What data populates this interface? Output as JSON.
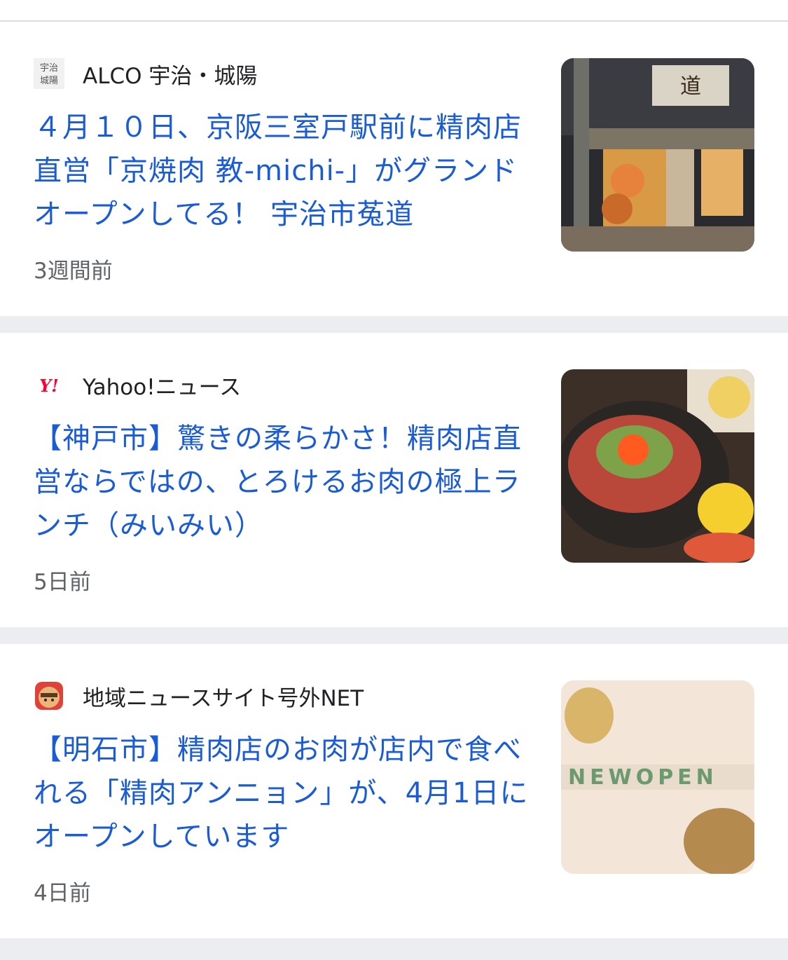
{
  "articles": [
    {
      "source": "ALCO 宇治・城陽",
      "icon": "alco-logo-icon",
      "icon_text": "宇治城陽",
      "headline": "４月１０日、京阪三室戸駅前に精肉店直営「京焼肉 教-michi-」がグランドオープンしてる！ 宇治市菟道",
      "time": "3週間前",
      "thumbnail": "storefront-photo"
    },
    {
      "source": "Yahoo!ニュース",
      "icon": "yahoo-logo-icon",
      "icon_text": "Y!",
      "headline": "【神戸市】驚きの柔らかさ！精肉店直営ならではの、とろけるお肉の極上ランチ（みいみい）",
      "time": "5日前",
      "thumbnail": "beef-bowl-photo"
    },
    {
      "source": "地域ニュースサイト号外NET",
      "icon": "gogai-net-logo-icon",
      "headline": "【明石市】精肉店のお肉が店内で食べれる「精肉アンニョン」が、4月1日にオープンしています",
      "time": "4日前",
      "thumbnail": "new-open-photo",
      "thumb_text": "NEWOPEN"
    }
  ],
  "colors": {
    "headline": "#1a5bd6",
    "source": "#202124",
    "time": "#5f6368",
    "separator": "#ebedf0",
    "yahoo_red": "#ff0033"
  }
}
